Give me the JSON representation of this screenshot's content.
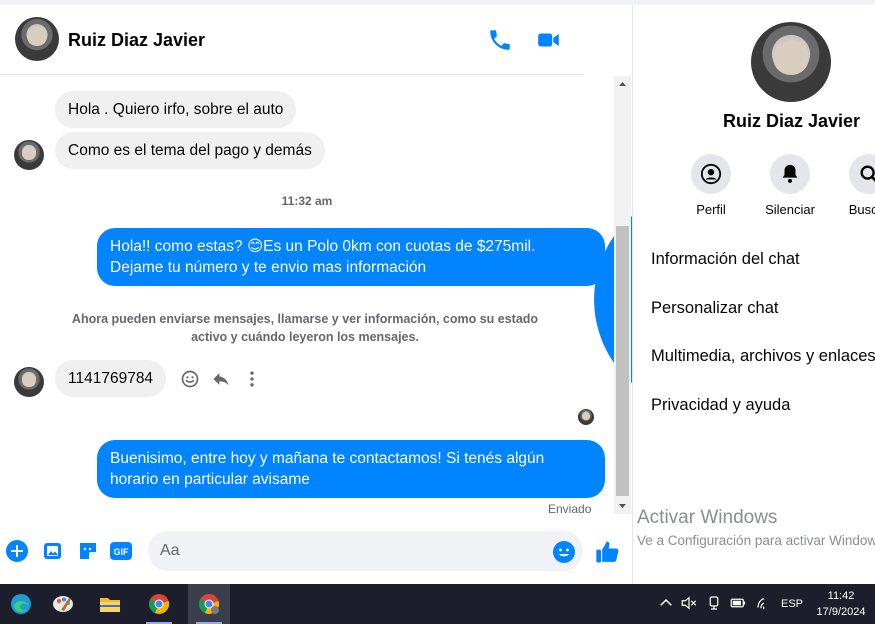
{
  "header": {
    "contact_name": "Ruiz Diaz Javier",
    "icons": [
      "phone-icon",
      "video-camera-icon",
      "info-icon"
    ]
  },
  "messages": {
    "incoming_1": "Hola . Quiero irfo, sobre el auto",
    "incoming_2": "Como es el tema del pago y demás",
    "timestamp": "11:32 am",
    "outgoing_1": "Hola!! como estas? 😊Es un Polo 0km con cuotas de $275mil. Dejame tu número y te envio mas información",
    "system_notice": "Ahora pueden enviarse mensajes, llamarse y ver información, como su estado activo y cuándo leyeron los mensajes.",
    "incoming_3": "1141769784",
    "outgoing_2": "Buenisimo, entre hoy y mañana te contactamos! Si tenés algún horario en particular avisame",
    "status": "Enviado"
  },
  "composer": {
    "placeholder": "Aa"
  },
  "info_panel": {
    "name": "Ruiz Diaz Javier",
    "actions": [
      {
        "label": "Perfil",
        "icon": "profile-icon"
      },
      {
        "label": "Silenciar",
        "icon": "bell-icon"
      },
      {
        "label": "Buscar",
        "icon": "search-icon"
      }
    ],
    "menu": [
      "Información del chat",
      "Personalizar chat",
      "Multimedia, archivos y enlaces",
      "Privacidad y ayuda"
    ]
  },
  "watermark": {
    "title": "Activar Windows",
    "subtitle": "Ve a Configuración para activar Windows."
  },
  "taskbar": {
    "language": "ESP",
    "time": "11:42",
    "date": "17/9/2024"
  },
  "colors": {
    "accent": "#0084ff",
    "incoming_bubble": "#f0f0f0",
    "taskbar": "#1c1f2b"
  }
}
